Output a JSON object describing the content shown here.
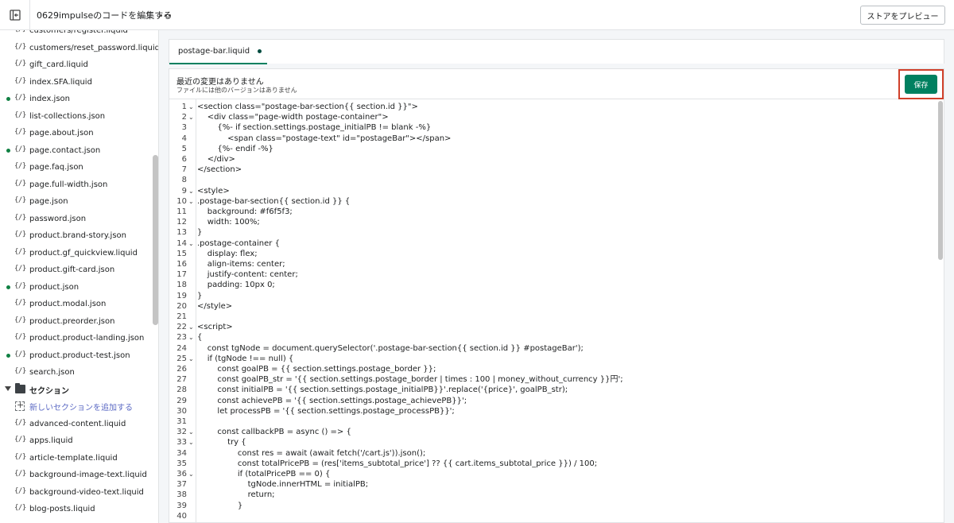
{
  "topbar": {
    "title": "0629impulseのコードを編集する",
    "preview_label": "ストアをプレビュー"
  },
  "sidebar": {
    "files_before": [
      {
        "name": "customers/register.liquid",
        "dot": false
      },
      {
        "name": "customers/reset_password.liquid",
        "dot": false
      },
      {
        "name": "gift_card.liquid",
        "dot": false
      },
      {
        "name": "index.SFA.liquid",
        "dot": false
      },
      {
        "name": "index.json",
        "dot": true
      },
      {
        "name": "list-collections.json",
        "dot": false
      },
      {
        "name": "page.about.json",
        "dot": false
      },
      {
        "name": "page.contact.json",
        "dot": true
      },
      {
        "name": "page.faq.json",
        "dot": false
      },
      {
        "name": "page.full-width.json",
        "dot": false
      },
      {
        "name": "page.json",
        "dot": false
      },
      {
        "name": "password.json",
        "dot": false
      },
      {
        "name": "product.brand-story.json",
        "dot": false
      },
      {
        "name": "product.gf_quickview.liquid",
        "dot": false
      },
      {
        "name": "product.gift-card.json",
        "dot": false
      },
      {
        "name": "product.json",
        "dot": true
      },
      {
        "name": "product.modal.json",
        "dot": false
      },
      {
        "name": "product.preorder.json",
        "dot": false
      },
      {
        "name": "product.product-landing.json",
        "dot": false
      },
      {
        "name": "product.product-test.json",
        "dot": true
      },
      {
        "name": "search.json",
        "dot": false
      }
    ],
    "folder_label": "セクション",
    "add_label": "新しいセクションを追加する",
    "files_after": [
      {
        "name": "advanced-content.liquid",
        "dot": false
      },
      {
        "name": "apps.liquid",
        "dot": false
      },
      {
        "name": "article-template.liquid",
        "dot": false
      },
      {
        "name": "background-image-text.liquid",
        "dot": false
      },
      {
        "name": "background-video-text.liquid",
        "dot": false
      },
      {
        "name": "blog-posts.liquid",
        "dot": false
      }
    ]
  },
  "tab": {
    "label": "postage-bar.liquid"
  },
  "status": {
    "main": "最近の変更はありません",
    "sub": "ファイルには他のバージョンはありません"
  },
  "save_label": "保存",
  "colors": {
    "accent": "#008060",
    "highlight": "#d0402a",
    "tag": "#202223",
    "attr": "#8a3a2c",
    "keyword": "#202223"
  },
  "code_lines": [
    {
      "n": "1",
      "f": true,
      "t": "<section class=\"postage-bar-section{{ section.id }}\">"
    },
    {
      "n": "2",
      "f": true,
      "t": "    <div class=\"page-width postage-container\">"
    },
    {
      "n": "3",
      "f": false,
      "t": "        {%- if section.settings.postage_initialPB != blank -%}"
    },
    {
      "n": "4",
      "f": false,
      "t": "            <span class=\"postage-text\" id=\"postageBar\"></span>"
    },
    {
      "n": "5",
      "f": false,
      "t": "        {%- endif -%}"
    },
    {
      "n": "6",
      "f": false,
      "t": "    </div>"
    },
    {
      "n": "7",
      "f": false,
      "t": "</section>"
    },
    {
      "n": "8",
      "f": false,
      "t": ""
    },
    {
      "n": "9",
      "f": true,
      "t": "<style>"
    },
    {
      "n": "10",
      "f": true,
      "t": ".postage-bar-section{{ section.id }} {"
    },
    {
      "n": "11",
      "f": false,
      "t": "    background: #f6f5f3;"
    },
    {
      "n": "12",
      "f": false,
      "t": "    width: 100%;"
    },
    {
      "n": "13",
      "f": false,
      "t": "}"
    },
    {
      "n": "14",
      "f": true,
      "t": ".postage-container {"
    },
    {
      "n": "15",
      "f": false,
      "t": "    display: flex;"
    },
    {
      "n": "16",
      "f": false,
      "t": "    align-items: center;"
    },
    {
      "n": "17",
      "f": false,
      "t": "    justify-content: center;"
    },
    {
      "n": "18",
      "f": false,
      "t": "    padding: 10px 0;"
    },
    {
      "n": "19",
      "f": false,
      "t": "}"
    },
    {
      "n": "20",
      "f": false,
      "t": "</style>"
    },
    {
      "n": "21",
      "f": false,
      "t": ""
    },
    {
      "n": "22",
      "f": true,
      "t": "<script>"
    },
    {
      "n": "23",
      "f": true,
      "t": "{"
    },
    {
      "n": "24",
      "f": false,
      "t": "    const tgNode = document.querySelector('.postage-bar-section{{ section.id }} #postageBar');"
    },
    {
      "n": "25",
      "f": true,
      "t": "    if (tgNode !== null) {"
    },
    {
      "n": "26",
      "f": false,
      "t": "        const goalPB = {{ section.settings.postage_border }};"
    },
    {
      "n": "27",
      "f": false,
      "t": "        const goalPB_str = '{{ section.settings.postage_border | times : 100 | money_without_currency }}円';"
    },
    {
      "n": "28",
      "f": false,
      "t": "        const initialPB = '{{ section.settings.postage_initialPB}}'.replace('{price}', goalPB_str);"
    },
    {
      "n": "29",
      "f": false,
      "t": "        const achievePB = '{{ section.settings.postage_achievePB}}';"
    },
    {
      "n": "30",
      "f": false,
      "t": "        let processPB = '{{ section.settings.postage_processPB}}';"
    },
    {
      "n": "31",
      "f": false,
      "t": ""
    },
    {
      "n": "32",
      "f": true,
      "t": "        const callbackPB = async () => {"
    },
    {
      "n": "33",
      "f": true,
      "t": "            try {"
    },
    {
      "n": "34",
      "f": false,
      "t": "                const res = await (await fetch('/cart.js')).json();"
    },
    {
      "n": "35",
      "f": false,
      "t": "                const totalPricePB = (res['items_subtotal_price'] ?? {{ cart.items_subtotal_price }}) / 100;"
    },
    {
      "n": "36",
      "f": true,
      "t": "                if (totalPricePB == 0) {"
    },
    {
      "n": "37",
      "f": false,
      "t": "                    tgNode.innerHTML = initialPB;"
    },
    {
      "n": "38",
      "f": false,
      "t": "                    return;"
    },
    {
      "n": "39",
      "f": false,
      "t": "                }"
    },
    {
      "n": "40",
      "f": false,
      "t": ""
    }
  ]
}
